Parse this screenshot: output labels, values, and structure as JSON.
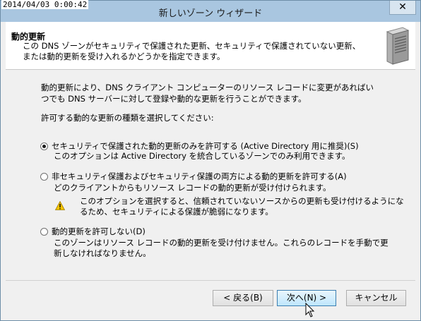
{
  "window": {
    "timestamp": "2014/04/03 0:00:42",
    "title": "新しいゾーン ウィザード",
    "close_label": "✕"
  },
  "header": {
    "title": "動的更新",
    "description": "この DNS ゾーンがセキュリティで保護された更新、セキュリティで保護されていない更新、または動的更新を受け入れるかどうかを指定できます。",
    "icon": "server-icon"
  },
  "body": {
    "intro": "動的更新により、DNS クライアント コンピューターのリソース レコードに変更があればいつでも DNS サーバーに対して登録や動的な更新を行うことができます。",
    "prompt": "許可する動的な更新の種類を選択してください:",
    "options": [
      {
        "label": "セキュリティで保護された動的更新のみを許可する (Active Directory 用に推奨)(S)",
        "description": "このオプションは Active Directory を統合しているゾーンでのみ利用できます。",
        "selected": true
      },
      {
        "label": "非セキュリティ保護およびセキュリティ保護の両方による動的更新を許可する(A)",
        "description": "どのクライアントからもリソース レコードの動的更新が受け付けられます。",
        "warning": "このオプションを選択すると、信頼されていないソースからの更新も受け付けるようになるため、セキュリティによる保護が脆弱になります。",
        "selected": false
      },
      {
        "label": "動的更新を許可しない(D)",
        "description": "このゾーンはリソース レコードの動的更新を受け付けません。これらのレコードを手動で更新しなければなりません。",
        "selected": false
      }
    ]
  },
  "buttons": {
    "back": "< 戻る(B)",
    "next": "次へ(N) >",
    "cancel": "キャンセル"
  },
  "colors": {
    "titlebar": "#a9c6e0",
    "primary_button": "#bee6fd",
    "warning": "#f5c400"
  }
}
